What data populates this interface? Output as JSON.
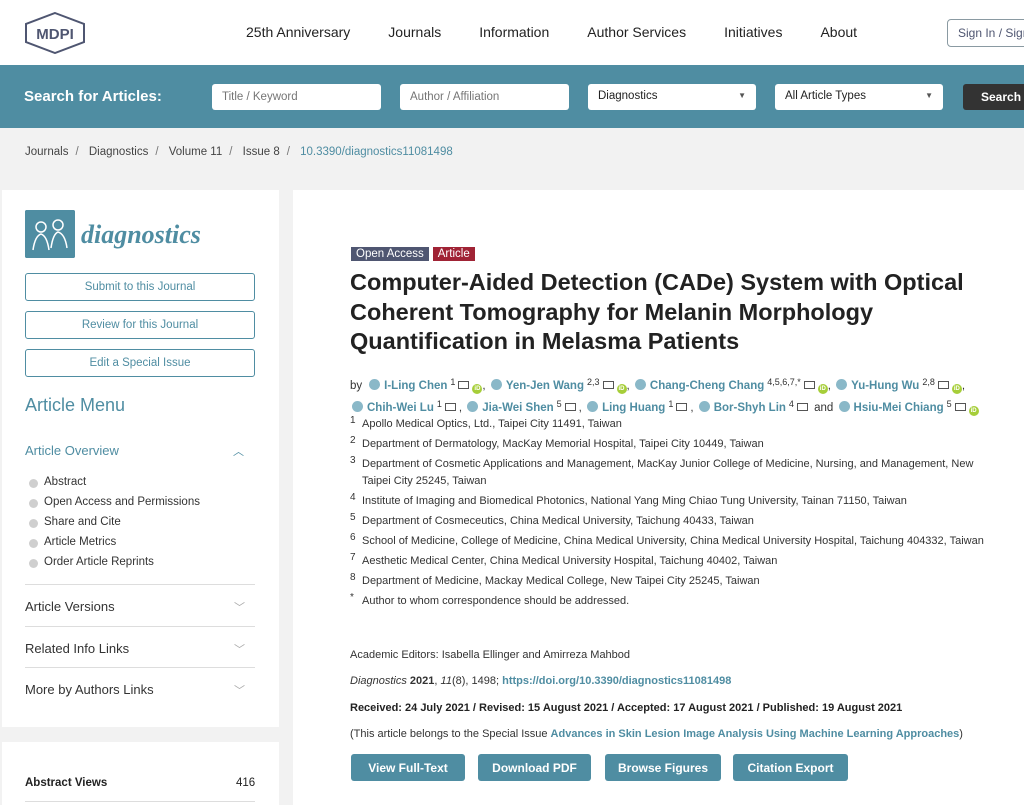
{
  "header": {
    "logo_text": "MDPI",
    "nav": [
      "25th Anniversary",
      "Journals",
      "Information",
      "Author Services",
      "Initiatives",
      "About"
    ],
    "signin": "Sign In / Sign Up"
  },
  "search": {
    "label": "Search for Articles:",
    "title_placeholder": "Title / Keyword",
    "author_placeholder": "Author / Affiliation",
    "journal_value": "Diagnostics",
    "type_value": "All Article Types",
    "button": "Search"
  },
  "breadcrumb": [
    "Journals",
    "Diagnostics",
    "Volume 11",
    "Issue 8",
    "10.3390/diagnostics11081498"
  ],
  "sidebar": {
    "journal_name": "diagnostics",
    "buttons": [
      "Submit to this Journal",
      "Review for this Journal",
      "Edit a Special Issue"
    ],
    "menu_title": "Article Menu",
    "overview": "Article Overview",
    "overview_items": [
      "Abstract",
      "Open Access and Permissions",
      "Share and Cite",
      "Article Metrics",
      "Order Article Reprints"
    ],
    "sections": [
      "Article Versions",
      "Related Info Links",
      "More by Authors Links"
    ],
    "stats_label": "Abstract Views",
    "stats_value": "416"
  },
  "article": {
    "badges": [
      "Open Access",
      "Article"
    ],
    "title": "Computer-Aided Detection (CADe) System with Optical Coherent Tomography for Melanin Morphology Quantification in Melasma Patients",
    "by": "by",
    "and": "and",
    "authors": [
      {
        "name": "I-Ling Chen",
        "aff": "1"
      },
      {
        "name": "Yen-Jen Wang",
        "aff": "2,3"
      },
      {
        "name": "Chang-Cheng Chang",
        "aff": "4,5,6,7,*"
      },
      {
        "name": "Yu-Hung Wu",
        "aff": "2,8"
      },
      {
        "name": "Chih-Wei Lu",
        "aff": "1"
      },
      {
        "name": "Jia-Wei Shen",
        "aff": "5"
      },
      {
        "name": "Ling Huang",
        "aff": "1"
      },
      {
        "name": "Bor-Shyh Lin",
        "aff": "4"
      },
      {
        "name": "Hsiu-Mei Chiang",
        "aff": "5"
      }
    ],
    "affiliations": [
      {
        "n": "1",
        "text": "Apollo Medical Optics, Ltd., Taipei City 11491, Taiwan"
      },
      {
        "n": "2",
        "text": "Department of Dermatology, MacKay Memorial Hospital, Taipei City 10449, Taiwan"
      },
      {
        "n": "3",
        "text": "Department of Cosmetic Applications and Management, MacKay Junior College of Medicine, Nursing, and Management, New Taipei City 25245, Taiwan"
      },
      {
        "n": "4",
        "text": "Institute of Imaging and Biomedical Photonics, National Yang Ming Chiao Tung University, Tainan 71150, Taiwan"
      },
      {
        "n": "5",
        "text": "Department of Cosmeceutics, China Medical University, Taichung 40433, Taiwan"
      },
      {
        "n": "6",
        "text": "School of Medicine, College of Medicine, China Medical University, China Medical University Hospital, Taichung 404332, Taiwan"
      },
      {
        "n": "7",
        "text": "Aesthetic Medical Center, China Medical University Hospital, Taichung 40402, Taiwan"
      },
      {
        "n": "8",
        "text": "Department of Medicine, Mackay Medical College, New Taipei City 25245, Taiwan"
      },
      {
        "n": "*",
        "text": "Author to whom correspondence should be addressed."
      }
    ],
    "editors": "Academic Editors: Isabella Ellinger and Amirreza Mahbod",
    "cite_journal": "Diagnostics",
    "cite_year": "2021",
    "cite_vol": "11",
    "cite_issue_pages": "(8), 1498; ",
    "cite_doi": "https://doi.org/10.3390/diagnostics11081498",
    "dates": "Received: 24 July 2021 / Revised: 15 August 2021 / Accepted: 17 August 2021 / Published: 19 August 2021",
    "special_prefix": "(This article belongs to the Special Issue ",
    "special_link": "Advances in Skin Lesion Image Analysis Using Machine Learning Approaches",
    "special_suffix": ")",
    "actions": [
      "View Full-Text",
      "Download PDF",
      "Browse Figures",
      "Citation Export"
    ]
  },
  "colors": {
    "teal": "#4f8da2",
    "navy": "#4f5671",
    "red": "#a02335",
    "orcid": "#a6ce39"
  }
}
